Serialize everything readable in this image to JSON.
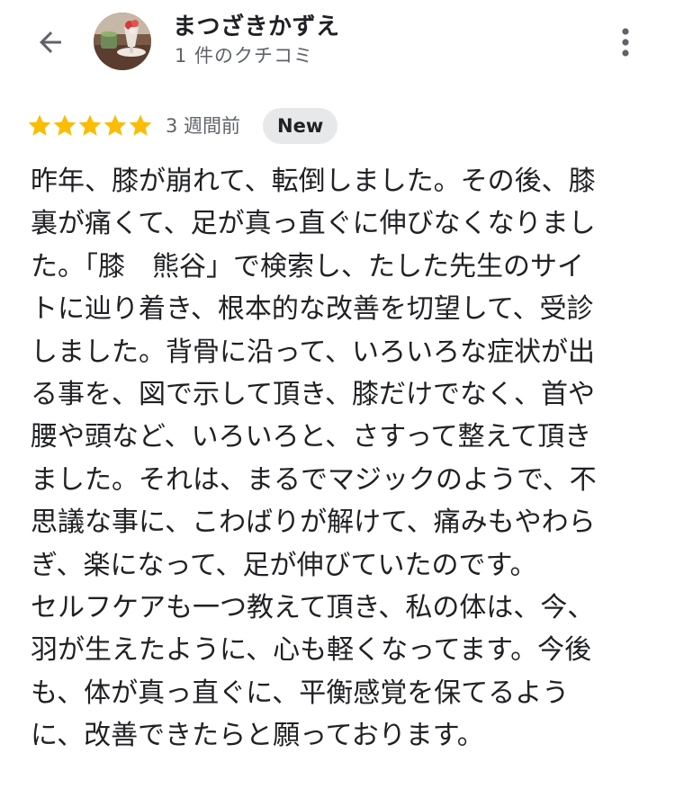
{
  "header": {
    "back_icon": "arrow-left-icon",
    "avatar_icon": "profile-photo",
    "user_name": "まつざきかずえ",
    "review_count": "1 件のクチコミ",
    "more_icon": "more-vert-icon"
  },
  "review": {
    "rating": 5,
    "time_ago": "3 週間前",
    "badge": "New",
    "lines": [
      "昨年、膝が崩れて、転倒しました。その後、膝",
      "裏が痛くて、足が真っ直ぐに伸びなくなりまし",
      "た。「膝　熊谷」で検索し、たした先生のサイ",
      "トに辿り着き、根本的な改善を切望して、受診",
      "しました。背骨に沿って、いろいろな症状が出",
      "る事を、図で示して頂き、膝だけでなく、首や",
      "腰や頭など、いろいろと、さすって整えて頂き",
      "ました。それは、まるでマジックのようで、不",
      "思議な事に、こわばりが解けて、痛みもやわら",
      "ぎ、楽になって、足が伸びていたのです。",
      "セルフケアも一つ教えて頂き、私の体は、今、",
      "羽が生えたように、心も軽くなってます。今後",
      "も、体が真っ直ぐに、平衡感覚を保てるよう",
      "に、改善できたらと願っております。"
    ]
  },
  "colors": {
    "star": "#fbbc04",
    "text_primary": "#202124",
    "text_secondary": "#5f6368",
    "badge_bg": "#e6e8ea"
  }
}
